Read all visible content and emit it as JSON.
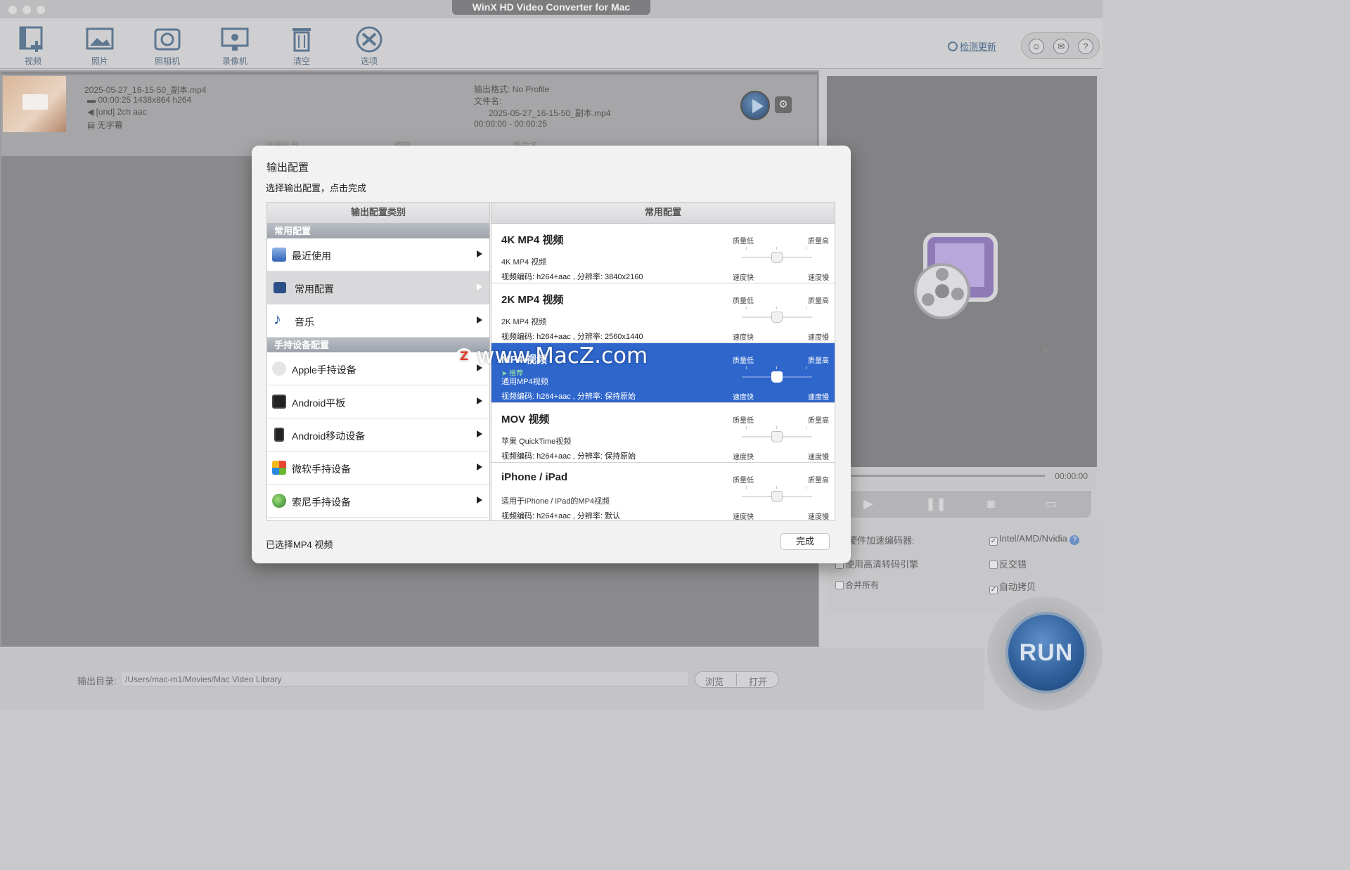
{
  "window": {
    "title": "WinX HD Video Converter for Mac"
  },
  "toolbar": {
    "buttons": [
      {
        "label": "视频",
        "icon": "add-video-icon"
      },
      {
        "label": "照片",
        "icon": "photo-icon"
      },
      {
        "label": "照相机",
        "icon": "camera-icon"
      },
      {
        "label": "录像机",
        "icon": "recorder-icon"
      },
      {
        "label": "清空",
        "icon": "trash-icon"
      },
      {
        "label": "选项",
        "icon": "options-icon"
      }
    ],
    "update_link": "检测更新",
    "round_buttons": [
      "user-icon",
      "mail-icon",
      "help-icon"
    ]
  },
  "file": {
    "name": "2025-05-27_16-15-50_副本.mp4",
    "video": "00:00:25 1438x864 h264",
    "audio": "[und] 2ch aac",
    "subtitle": "无字幕",
    "output_format": "输出格式: No Profile",
    "filename_label": "文件名:",
    "output_name": "2025-05-27_16-15-50_副本.mp4",
    "range": "00:00:00 - 00:00:25",
    "actions": [
      "详细信息",
      "编辑",
      "重命名"
    ]
  },
  "preview": {
    "time": "00:00:00",
    "question": "?"
  },
  "options": {
    "hw_accel_label": "硬件加速编码器:",
    "hw_accel_value": "Intel/AMD/Nvidia",
    "hq_engine": "使用高清转码引擎",
    "deinterlace": "反交错",
    "merge": "合并所有",
    "autocopy": "自动拷贝",
    "run": "RUN"
  },
  "bottom": {
    "output_label": "输出目录:",
    "output_path": "/Users/mac-m1/Movies/Mac Video Library",
    "browse": "浏览",
    "open": "打开"
  },
  "dialog": {
    "title": "输出配置",
    "subtitle": "选择输出配置，点击完成",
    "left_header": "输出配置类别",
    "right_header": "常用配置",
    "section1": "常用配置",
    "section2": "手持设备配置",
    "categories": [
      {
        "label": "最近使用",
        "icon": "recent-icon"
      },
      {
        "label": "常用配置",
        "icon": "clapper-icon"
      },
      {
        "label": "音乐",
        "icon": "music-note-icon"
      },
      {
        "label": "Apple手持设备",
        "icon": "apple-icon"
      },
      {
        "label": "Android平板",
        "icon": "android-tablet-icon"
      },
      {
        "label": "Android移动设备",
        "icon": "android-phone-icon"
      },
      {
        "label": "微软手持设备",
        "icon": "windows-icon"
      },
      {
        "label": "索尼手持设备",
        "icon": "sony-icon"
      }
    ],
    "profiles": [
      {
        "title": "4K MP4 视频",
        "desc": "4K MP4 视频",
        "spec": "视频编码: h264+aac , 分辨率: 3840x2160",
        "quality": 0.5
      },
      {
        "title": "2K MP4 视频",
        "desc": "2K MP4 视频",
        "spec": "视频编码: h264+aac , 分辨率: 2560x1440",
        "quality": 0.5
      },
      {
        "title": "MP4 视频",
        "recommend": "➤ 推荐",
        "desc": "通用MP4视频",
        "spec": "视频编码: h264+aac , 分辨率: 保持原始",
        "quality": 0.5
      },
      {
        "title": "MOV 视频",
        "desc": "苹果 QuickTime视频",
        "spec": "视频编码: h264+aac , 分辨率: 保持原始",
        "quality": 0.5
      },
      {
        "title": "iPhone / iPad",
        "desc": "适用于iPhone / iPad的MP4视频",
        "spec": "视频编码: h264+aac , 分辨率: 默认",
        "quality": 0.5
      }
    ],
    "q_low": "质量低",
    "q_high": "质量高",
    "s_fast": "速度快",
    "s_slow": "速度慢",
    "status": "已选择MP4 视频",
    "done": "完成"
  },
  "watermark": {
    "badge": "Z",
    "text": "www.MacZ.com"
  },
  "colors": {
    "selection": "#2f66cc",
    "run": "#2d5d98"
  }
}
